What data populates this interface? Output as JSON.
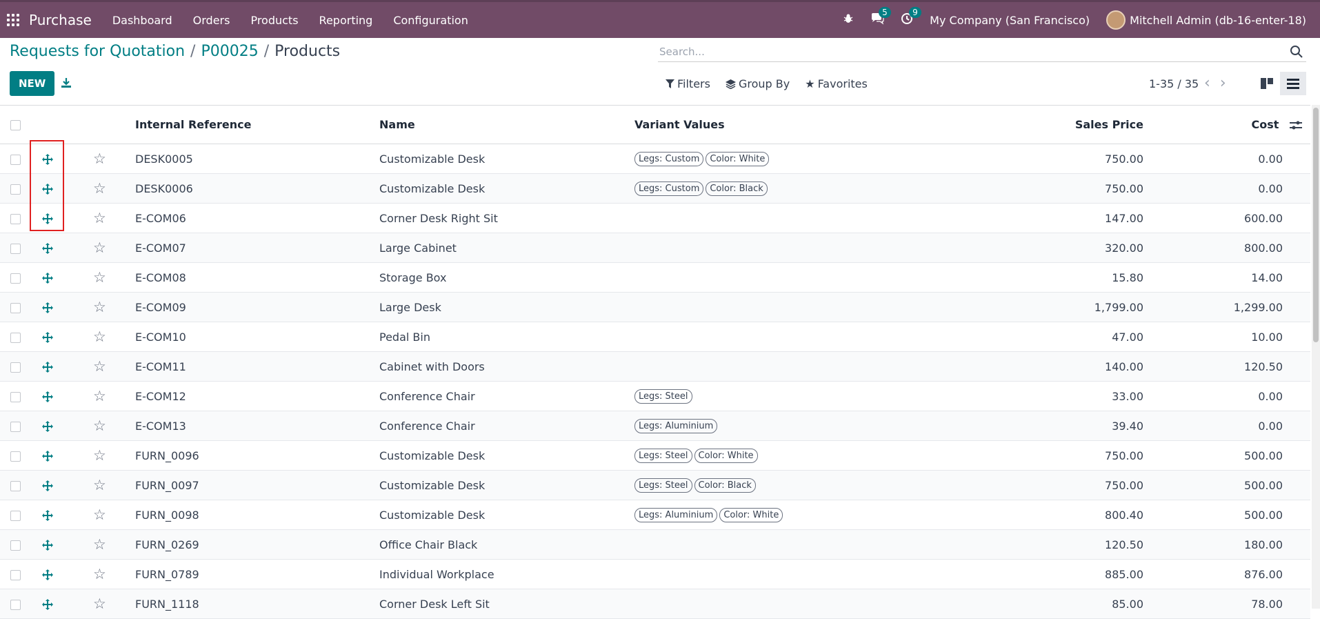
{
  "navbar": {
    "app_name": "Purchase",
    "menu": [
      "Dashboard",
      "Orders",
      "Products",
      "Reporting",
      "Configuration"
    ],
    "messages_count": "5",
    "activities_count": "9",
    "company": "My Company (San Francisco)",
    "user": "Mitchell Admin (db-16-enter-18)",
    "brand_color": "#714B67"
  },
  "breadcrumb": {
    "items": [
      "Requests for Quotation",
      "P00025"
    ],
    "current": "Products"
  },
  "search": {
    "placeholder": "Search..."
  },
  "toolbar": {
    "new_label": "NEW",
    "filters_label": "Filters",
    "groupby_label": "Group By",
    "favorites_label": "Favorites",
    "pager": "1-35 / 35"
  },
  "table": {
    "headers": [
      "Internal Reference",
      "Name",
      "Variant Values",
      "Sales Price",
      "Cost"
    ],
    "rows": [
      {
        "ref": "DESK0005",
        "name": "Customizable Desk",
        "tags": [
          "Legs: Custom",
          "Color: White"
        ],
        "price": "750.00",
        "cost": "0.00"
      },
      {
        "ref": "DESK0006",
        "name": "Customizable Desk",
        "tags": [
          "Legs: Custom",
          "Color: Black"
        ],
        "price": "750.00",
        "cost": "0.00"
      },
      {
        "ref": "E-COM06",
        "name": "Corner Desk Right Sit",
        "tags": [],
        "price": "147.00",
        "cost": "600.00"
      },
      {
        "ref": "E-COM07",
        "name": "Large Cabinet",
        "tags": [],
        "price": "320.00",
        "cost": "800.00"
      },
      {
        "ref": "E-COM08",
        "name": "Storage Box",
        "tags": [],
        "price": "15.80",
        "cost": "14.00"
      },
      {
        "ref": "E-COM09",
        "name": "Large Desk",
        "tags": [],
        "price": "1,799.00",
        "cost": "1,299.00"
      },
      {
        "ref": "E-COM10",
        "name": "Pedal Bin",
        "tags": [],
        "price": "47.00",
        "cost": "10.00"
      },
      {
        "ref": "E-COM11",
        "name": "Cabinet with Doors",
        "tags": [],
        "price": "140.00",
        "cost": "120.50"
      },
      {
        "ref": "E-COM12",
        "name": "Conference Chair",
        "tags": [
          "Legs: Steel"
        ],
        "price": "33.00",
        "cost": "0.00"
      },
      {
        "ref": "E-COM13",
        "name": "Conference Chair",
        "tags": [
          "Legs: Aluminium"
        ],
        "price": "39.40",
        "cost": "0.00"
      },
      {
        "ref": "FURN_0096",
        "name": "Customizable Desk",
        "tags": [
          "Legs: Steel",
          "Color: White"
        ],
        "price": "750.00",
        "cost": "500.00"
      },
      {
        "ref": "FURN_0097",
        "name": "Customizable Desk",
        "tags": [
          "Legs: Steel",
          "Color: Black"
        ],
        "price": "750.00",
        "cost": "500.00"
      },
      {
        "ref": "FURN_0098",
        "name": "Customizable Desk",
        "tags": [
          "Legs: Aluminium",
          "Color: White"
        ],
        "price": "800.40",
        "cost": "500.00"
      },
      {
        "ref": "FURN_0269",
        "name": "Office Chair Black",
        "tags": [],
        "price": "120.50",
        "cost": "180.00"
      },
      {
        "ref": "FURN_0789",
        "name": "Individual Workplace",
        "tags": [],
        "price": "885.00",
        "cost": "876.00"
      },
      {
        "ref": "FURN_1118",
        "name": "Corner Desk Left Sit",
        "tags": [],
        "price": "85.00",
        "cost": "78.00"
      }
    ]
  }
}
